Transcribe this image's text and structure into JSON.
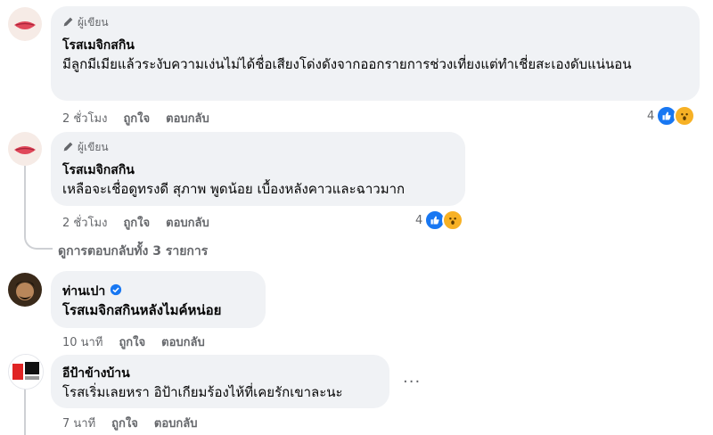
{
  "comments": [
    {
      "badge": "ผู้เขียน",
      "name": "โรสเมจิกสกิน",
      "text": "มีลูกมีเมียแล้วระงับความเง่นไม่ได้ชื่อเสียงโด่งดังจากออกรายการช่วงเที่ยงแต่ทำเชี่ยสะเองดับแน่นอน",
      "time": "2 ชั่วโมง",
      "like": "ถูกใจ",
      "reply": "ตอบกลับ",
      "reactions": "4"
    },
    {
      "badge": "ผู้เขียน",
      "name": "โรสเมจิกสกิน",
      "text": "เหลือจะเชื่อดูทรงดี สุภาพ พูดน้อย เบื้องหลังคาวและฉาวมาก",
      "time": "2 ชั่วโมง",
      "like": "ถูกใจ",
      "reply": "ตอบกลับ",
      "reactions": "4"
    },
    {
      "name": "ท่านเปา",
      "text": "โรสเมจิกสกินหลังไมค์หน่อย",
      "time": "10 นาที",
      "like": "ถูกใจ",
      "reply": "ตอบกลับ"
    },
    {
      "name": "อีป้าข้างบ้าน",
      "text": "โรสเริ่มเลยหรา อิป้าเกียมร้องไห้ที่เคยรักเขาละนะ",
      "time": "7 นาที",
      "like": "ถูกใจ",
      "reply": "ตอบกลับ",
      "more": "···"
    }
  ],
  "view_replies": "ดูการตอบกลับทั้ง 3 รายการ",
  "colors": {
    "like_blue": "#1877f2",
    "wow_yellow": "#f7b125",
    "bubble": "#f0f2f5",
    "meta": "#65676b"
  }
}
